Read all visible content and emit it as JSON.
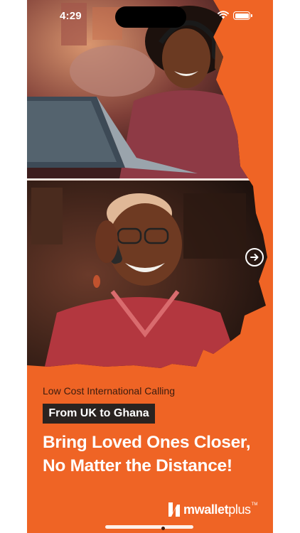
{
  "status_bar": {
    "time": "4:29",
    "wifi_icon": "wifi-icon",
    "battery_icon": "battery-icon"
  },
  "hero": {
    "top_photo": "woman-with-headset-and-laptop",
    "bottom_photo": "elderly-woman-on-phone"
  },
  "navigation": {
    "next_icon": "arrow-right-circle-icon"
  },
  "content": {
    "subtitle": "Low Cost International Calling",
    "route_badge": "From UK to Ghana",
    "headline_line1": "Bring Loved Ones Closer,",
    "headline_line2": "No Matter the Distance!"
  },
  "brand": {
    "name_bold": "mwallet",
    "name_light": "plus",
    "trademark": "TM"
  },
  "colors": {
    "brand_orange": "#ef6425",
    "badge_dark": "#2a2320",
    "text_white": "#ffffff",
    "subtitle_brown": "#3b1c0f"
  }
}
